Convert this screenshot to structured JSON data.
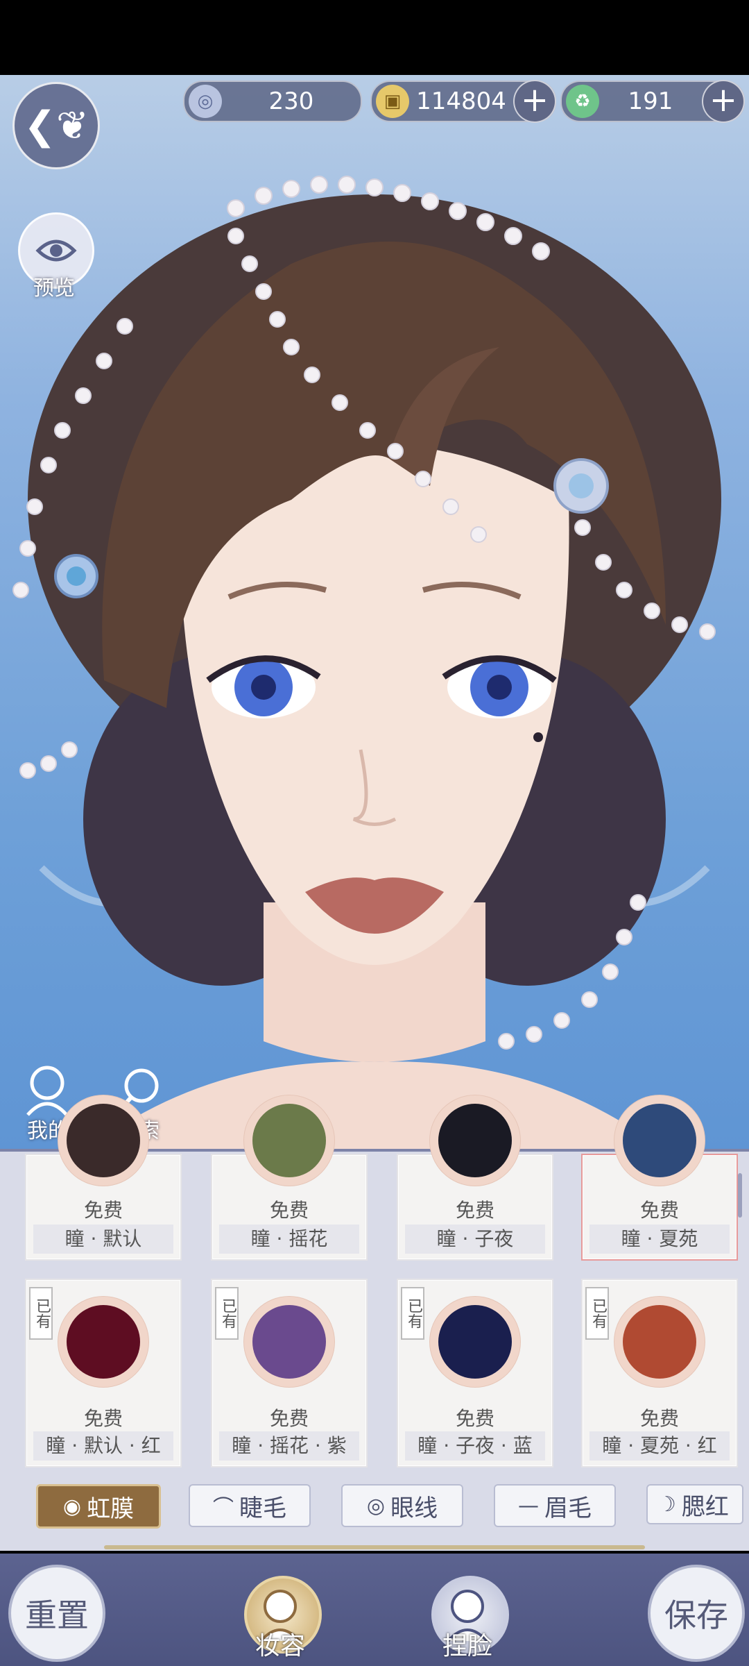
{
  "currencies": [
    {
      "icon": "silver-coin-icon",
      "value": "230",
      "has_plus": false
    },
    {
      "icon": "gold-coin-icon",
      "value": "114804",
      "has_plus": true
    },
    {
      "icon": "jade-icon",
      "value": "191",
      "has_plus": true
    }
  ],
  "side_buttons": {
    "back_icon": "butterfly-back-icon",
    "preview_label": "预览",
    "mine_label": "我的",
    "search_label": "搜索"
  },
  "grid": {
    "row1": [
      {
        "price": "免费",
        "name": "瞳 · 默认",
        "selected": false
      },
      {
        "price": "免费",
        "name": "瞳 · 摇花",
        "selected": false
      },
      {
        "price": "免费",
        "name": "瞳 · 子夜",
        "selected": false
      },
      {
        "price": "免费",
        "name": "瞳 · 夏苑",
        "selected": true
      }
    ],
    "row2": [
      {
        "owned": "已有",
        "price": "免费",
        "name": "瞳 · 默认 · 红",
        "color": "#5e0d22"
      },
      {
        "owned": "已有",
        "price": "免费",
        "name": "瞳 · 摇花 · 紫",
        "color": "#6a4a8e"
      },
      {
        "owned": "已有",
        "price": "免费",
        "name": "瞳 · 子夜 · 蓝",
        "color": "#1a1f4e"
      },
      {
        "owned": "已有",
        "price": "免费",
        "name": "瞳 · 夏苑 · 红",
        "color": "#b04a32"
      }
    ]
  },
  "tabs": [
    {
      "label": "虹膜",
      "icon": "iris-icon",
      "active": true
    },
    {
      "label": "睫毛",
      "icon": "eyelash-icon",
      "active": false
    },
    {
      "label": "眼线",
      "icon": "eye-icon",
      "active": false
    },
    {
      "label": "眉毛",
      "icon": "brow-icon",
      "active": false
    },
    {
      "label": "腮红",
      "icon": "blush-icon",
      "active": false
    }
  ],
  "bottom": {
    "reset_label": "重置",
    "makeup_label": "妆容",
    "face_label": "捏脸",
    "save_label": "保存"
  },
  "colors": {
    "accent_gold": "#8e6b3f",
    "panel_bg": "#d9dbe8",
    "bottom_bar": "#5c6390"
  }
}
